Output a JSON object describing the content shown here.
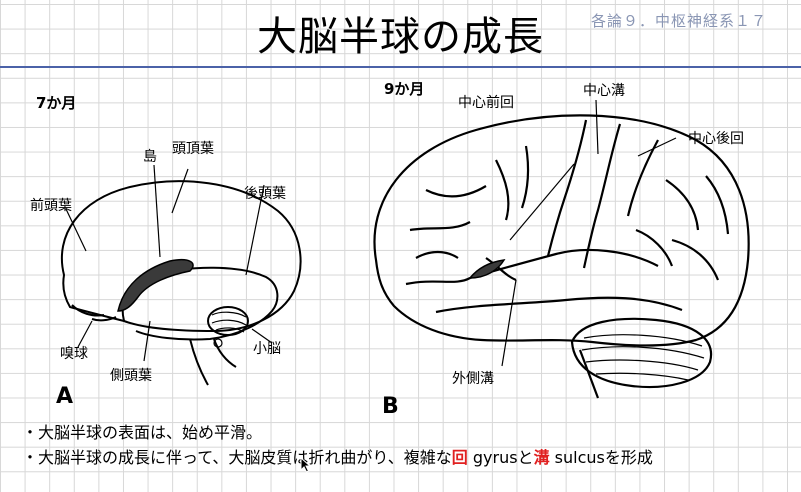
{
  "header": {
    "title": "大脳半球の成長",
    "subtitle": "各論９．中枢神経系１７"
  },
  "panel_a": {
    "age": "7か月",
    "panel_letter": "A",
    "labels": {
      "shima": "島",
      "parietal": "頭頂葉",
      "frontal": "前頭葉",
      "occipital": "後頭葉",
      "olfactory": "嗅球",
      "temporal": "側頭葉",
      "cerebellum": "小脳"
    }
  },
  "panel_b": {
    "age": "9か月",
    "panel_letter": "B",
    "labels": {
      "precentral": "中心前回",
      "central_sulcus": "中心溝",
      "postcentral": "中心後回",
      "lateral_sulcus": "外側溝"
    }
  },
  "notes": {
    "line1": "・大脳半球の表面は、始め平滑。",
    "line2_pre": "・大脳半球の成長に伴って、大脳皮質は折れ曲がり、複雑な",
    "gyrus_kanji": "回",
    "gyrus_en": " gyrus",
    "to": "と",
    "sulcus_kanji": "溝",
    "sulcus_en": " sulcus",
    "line2_post": "を形成"
  },
  "colors": {
    "rule": "#4b62a8",
    "subtitle": "#8a96b4",
    "highlight": "#e02020"
  }
}
